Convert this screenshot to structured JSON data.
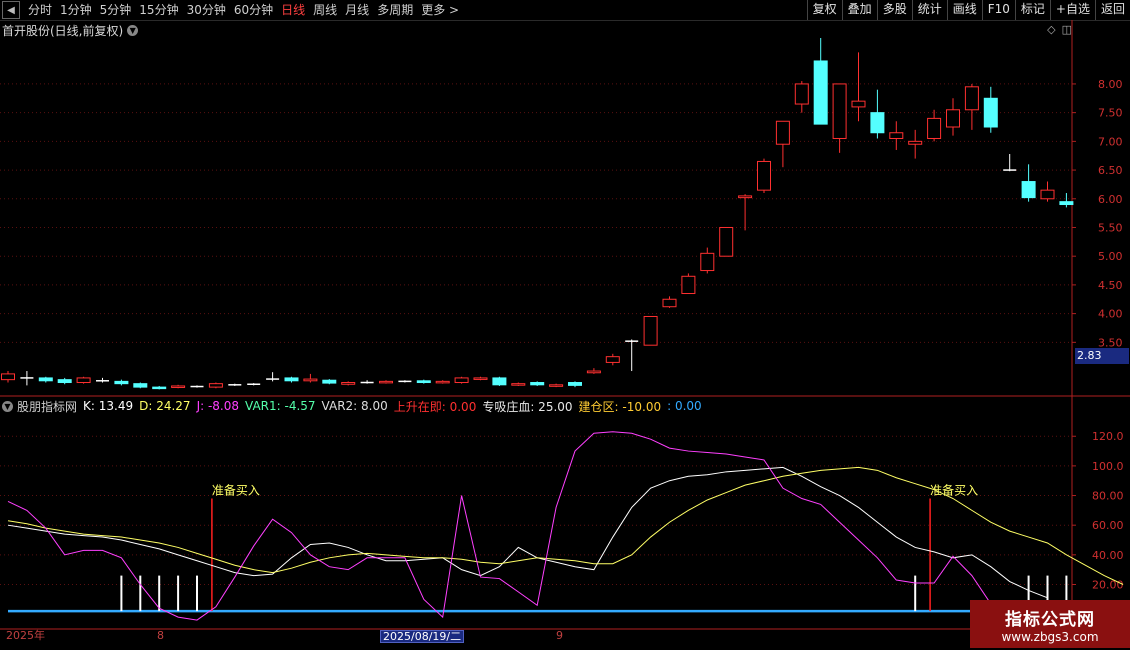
{
  "toolbar": {
    "back_icon": "left-arrow-icon",
    "periods": [
      "分时",
      "1分钟",
      "5分钟",
      "15分钟",
      "30分钟",
      "60分钟",
      "日线",
      "周线",
      "月线",
      "多周期",
      "更多 >"
    ],
    "active_period": "日线",
    "right_buttons": [
      "复权",
      "叠加",
      "多股",
      "统计",
      "画线",
      "F10",
      "标记",
      "+自选",
      "返回"
    ]
  },
  "main_chart": {
    "title": "首开股份(日线,前复权)",
    "price_ticks": [
      "8.00",
      "7.50",
      "7.00",
      "6.50",
      "6.00",
      "5.50",
      "5.00",
      "4.50",
      "4.00",
      "3.50"
    ],
    "last_price": "2.83"
  },
  "indicator": {
    "name": "股朋指标网",
    "k_label": "K: 13.49",
    "d_label": "D: 24.27",
    "j_label": "J: -8.08",
    "var1_label": "VAR1: -4.57",
    "var2_label": "VAR2: 8.00",
    "rise_label": "上升在即: 0.00",
    "absorb_label": "专吸庄血: 25.00",
    "build_label": "建仓区: -10.00",
    "extra_label": ": 0.00",
    "ticks": [
      "120.0",
      "100.0",
      "80.00",
      "60.00",
      "40.00",
      "20.00"
    ],
    "signal_text": "准备买入"
  },
  "date_axis": {
    "year": "2025年",
    "month1": "8",
    "selected": "2025/08/19/二",
    "month2": "9"
  },
  "colors": {
    "up": "#ff3030",
    "down": "#54ffff",
    "k": "#ffffff",
    "d": "#ffff66",
    "j": "#ff40ff",
    "base": "#33aaff"
  },
  "watermark": {
    "line1": "指标公式网",
    "line2": "www.zbgs3.com"
  },
  "chart_data": {
    "type": "candlestick",
    "price_axis_range": [
      2.6,
      8.8
    ],
    "candles": [
      {
        "o": 2.85,
        "c": 2.95,
        "h": 3.0,
        "l": 2.8
      },
      {
        "o": 2.88,
        "c": 2.88,
        "h": 3.0,
        "l": 2.75
      },
      {
        "o": 2.88,
        "c": 2.83,
        "h": 2.9,
        "l": 2.8
      },
      {
        "o": 2.85,
        "c": 2.8,
        "h": 2.88,
        "l": 2.77
      },
      {
        "o": 2.8,
        "c": 2.88,
        "h": 2.9,
        "l": 2.78
      },
      {
        "o": 2.83,
        "c": 2.83,
        "h": 2.88,
        "l": 2.8
      },
      {
        "o": 2.82,
        "c": 2.78,
        "h": 2.85,
        "l": 2.75
      },
      {
        "o": 2.78,
        "c": 2.72,
        "h": 2.8,
        "l": 2.7
      },
      {
        "o": 2.72,
        "c": 2.7,
        "h": 2.74,
        "l": 2.68
      },
      {
        "o": 2.72,
        "c": 2.74,
        "h": 2.76,
        "l": 2.7
      },
      {
        "o": 2.73,
        "c": 2.73,
        "h": 2.75,
        "l": 2.71
      },
      {
        "o": 2.72,
        "c": 2.78,
        "h": 2.8,
        "l": 2.7
      },
      {
        "o": 2.76,
        "c": 2.76,
        "h": 2.78,
        "l": 2.74
      },
      {
        "o": 2.77,
        "c": 2.77,
        "h": 2.79,
        "l": 2.75
      },
      {
        "o": 2.86,
        "c": 2.86,
        "h": 2.98,
        "l": 2.82
      },
      {
        "o": 2.88,
        "c": 2.83,
        "h": 2.9,
        "l": 2.8
      },
      {
        "o": 2.83,
        "c": 2.86,
        "h": 2.95,
        "l": 2.8
      },
      {
        "o": 2.84,
        "c": 2.79,
        "h": 2.86,
        "l": 2.77
      },
      {
        "o": 2.77,
        "c": 2.8,
        "h": 2.82,
        "l": 2.75
      },
      {
        "o": 2.8,
        "c": 2.8,
        "h": 2.84,
        "l": 2.78
      },
      {
        "o": 2.8,
        "c": 2.82,
        "h": 2.84,
        "l": 2.78
      },
      {
        "o": 2.82,
        "c": 2.82,
        "h": 2.84,
        "l": 2.8
      },
      {
        "o": 2.83,
        "c": 2.8,
        "h": 2.85,
        "l": 2.78
      },
      {
        "o": 2.8,
        "c": 2.82,
        "h": 2.84,
        "l": 2.78
      },
      {
        "o": 2.8,
        "c": 2.88,
        "h": 2.9,
        "l": 2.78
      },
      {
        "o": 2.86,
        "c": 2.88,
        "h": 2.9,
        "l": 2.84
      },
      {
        "o": 2.88,
        "c": 2.76,
        "h": 2.9,
        "l": 2.74
      },
      {
        "o": 2.76,
        "c": 2.78,
        "h": 2.8,
        "l": 2.74
      },
      {
        "o": 2.8,
        "c": 2.76,
        "h": 2.82,
        "l": 2.74
      },
      {
        "o": 2.74,
        "c": 2.76,
        "h": 2.78,
        "l": 2.72
      },
      {
        "o": 2.8,
        "c": 2.75,
        "h": 2.82,
        "l": 2.72
      },
      {
        "o": 2.97,
        "c": 3.0,
        "h": 3.05,
        "l": 2.95
      },
      {
        "o": 3.15,
        "c": 3.25,
        "h": 3.3,
        "l": 3.1
      },
      {
        "o": 3.52,
        "c": 3.52,
        "h": 3.55,
        "l": 3.0
      },
      {
        "o": 3.45,
        "c": 3.95,
        "h": 3.95,
        "l": 3.45
      },
      {
        "o": 4.12,
        "c": 4.25,
        "h": 4.3,
        "l": 4.1
      },
      {
        "o": 4.35,
        "c": 4.65,
        "h": 4.7,
        "l": 4.35
      },
      {
        "o": 4.75,
        "c": 5.05,
        "h": 5.15,
        "l": 4.7
      },
      {
        "o": 5.0,
        "c": 5.5,
        "h": 5.5,
        "l": 5.0
      },
      {
        "o": 6.02,
        "c": 6.05,
        "h": 6.08,
        "l": 5.45
      },
      {
        "o": 6.15,
        "c": 6.65,
        "h": 6.7,
        "l": 6.1
      },
      {
        "o": 6.95,
        "c": 7.35,
        "h": 7.35,
        "l": 6.55
      },
      {
        "o": 7.65,
        "c": 8.0,
        "h": 8.05,
        "l": 7.5
      },
      {
        "o": 8.4,
        "c": 7.3,
        "h": 8.8,
        "l": 7.3
      },
      {
        "o": 7.05,
        "c": 8.0,
        "h": 8.0,
        "l": 6.8
      },
      {
        "o": 7.6,
        "c": 7.7,
        "h": 8.55,
        "l": 7.35
      },
      {
        "o": 7.5,
        "c": 7.15,
        "h": 7.9,
        "l": 7.05
      },
      {
        "o": 7.05,
        "c": 7.15,
        "h": 7.35,
        "l": 6.85
      },
      {
        "o": 6.95,
        "c": 7.0,
        "h": 7.2,
        "l": 6.7
      },
      {
        "o": 7.05,
        "c": 7.4,
        "h": 7.55,
        "l": 7.0
      },
      {
        "o": 7.25,
        "c": 7.55,
        "h": 7.75,
        "l": 7.1
      },
      {
        "o": 7.55,
        "c": 7.95,
        "h": 8.0,
        "l": 7.2
      },
      {
        "o": 7.75,
        "c": 7.25,
        "h": 7.95,
        "l": 7.15
      },
      {
        "o": 6.5,
        "c": 6.5,
        "h": 6.78,
        "l": 6.48
      },
      {
        "o": 6.3,
        "c": 6.02,
        "h": 6.6,
        "l": 5.95
      },
      {
        "o": 6.0,
        "c": 6.15,
        "h": 6.3,
        "l": 5.95
      },
      {
        "o": 5.95,
        "c": 5.9,
        "h": 6.1,
        "l": 5.85
      }
    ],
    "indicator_axis_range": [
      -8,
      135
    ],
    "indicator_series": [
      {
        "name": "K",
        "values": [
          60,
          58,
          56,
          54,
          53,
          52,
          50,
          47,
          44,
          40,
          36,
          32,
          28,
          26,
          27,
          38,
          47,
          48,
          45,
          40,
          36,
          36,
          37,
          38,
          30,
          26,
          32,
          45,
          38,
          35,
          32,
          30,
          52,
          72,
          85,
          90,
          93,
          94,
          96,
          97,
          98,
          99,
          93,
          86,
          80,
          72,
          62,
          52,
          45,
          42,
          38,
          40,
          32,
          22,
          16,
          11
        ]
      },
      {
        "name": "D",
        "values": [
          63,
          61,
          58,
          56,
          54,
          53,
          52,
          50,
          48,
          45,
          41,
          37,
          33,
          30,
          28,
          31,
          35,
          38,
          40,
          41,
          40,
          39,
          38,
          38,
          37,
          35,
          34,
          36,
          38,
          37,
          36,
          34,
          34,
          40,
          52,
          62,
          70,
          77,
          82,
          87,
          90,
          93,
          95,
          97,
          98,
          99,
          97,
          92,
          88,
          84,
          78,
          70,
          62,
          56,
          52,
          48,
          40,
          33,
          26,
          20
        ]
      },
      {
        "name": "J",
        "values": [
          76,
          70,
          58,
          40,
          43,
          43,
          38,
          20,
          4,
          -2,
          -4,
          5,
          25,
          46,
          64,
          55,
          40,
          32,
          30,
          38,
          38,
          38,
          10,
          -2,
          80,
          25,
          24,
          15,
          6,
          72,
          110,
          122,
          123,
          122,
          118,
          112,
          110,
          109,
          108,
          106,
          104,
          85,
          78,
          74,
          62,
          50,
          38,
          23,
          21,
          21,
          39,
          26,
          7,
          -8
        ]
      }
    ]
  }
}
